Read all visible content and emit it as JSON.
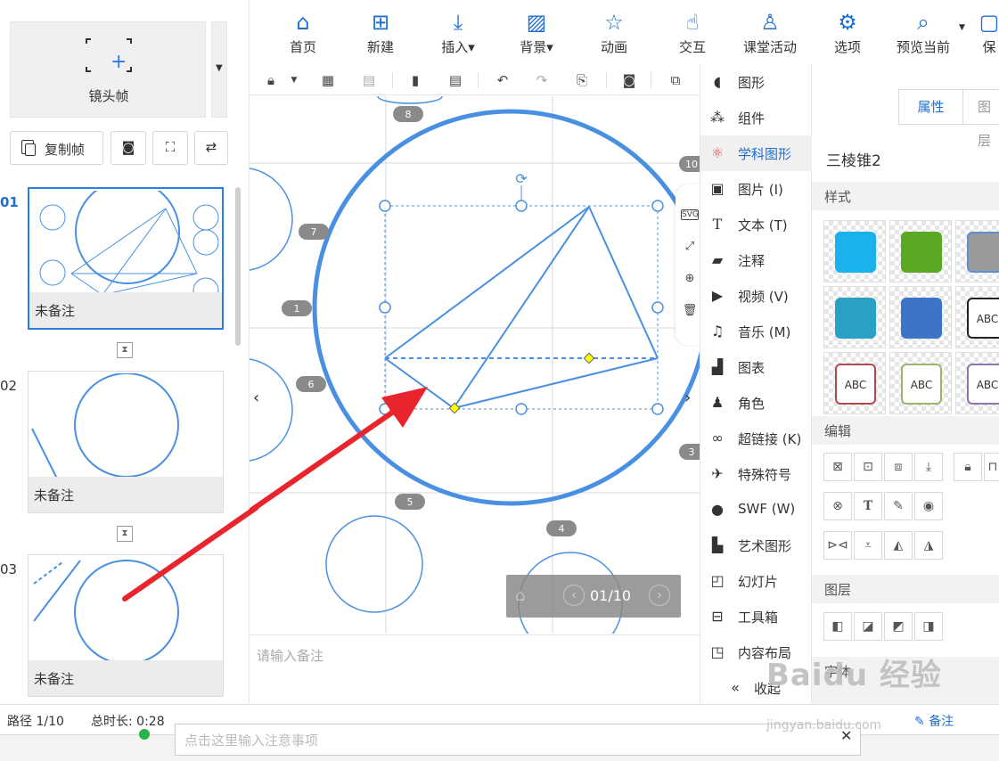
{
  "left_panel": {
    "lens_frame_label": "镜头帧",
    "copy_frame_label": "复制帧",
    "frames": [
      {
        "number": "01",
        "note": "未备注",
        "active": true
      },
      {
        "number": "02",
        "note": "未备注",
        "active": false
      },
      {
        "number": "03",
        "note": "未备注",
        "active": false
      }
    ]
  },
  "toolbar": {
    "items": [
      {
        "label": "首页",
        "icon": "home-icon"
      },
      {
        "label": "新建",
        "icon": "new-icon"
      },
      {
        "label": "插入",
        "icon": "insert-icon",
        "has_dropdown": true
      },
      {
        "label": "背景",
        "icon": "background-icon",
        "has_dropdown": true
      },
      {
        "label": "动画",
        "icon": "animation-icon"
      },
      {
        "label": "交互",
        "icon": "interaction-icon"
      },
      {
        "label": "课堂活动",
        "icon": "class-activity-icon"
      },
      {
        "label": "选项",
        "icon": "options-icon"
      },
      {
        "label": "预览当前",
        "icon": "preview-icon",
        "has_dropdown": true
      },
      {
        "label": "保",
        "icon": "save-icon"
      }
    ]
  },
  "canvas": {
    "path_markers": [
      "8",
      "7",
      "1",
      "6",
      "5",
      "4",
      "10",
      "3"
    ],
    "notes_placeholder": "请输入备注",
    "pager": {
      "text": "01/10"
    }
  },
  "insert_menu": {
    "items": [
      {
        "label": "图形",
        "icon": "shape-icon"
      },
      {
        "label": "组件",
        "icon": "component-icon"
      },
      {
        "label": "学科图形",
        "icon": "subject-shape-icon",
        "active": true
      },
      {
        "label": "图片 (I)",
        "icon": "image-icon"
      },
      {
        "label": "文本 (T)",
        "icon": "text-icon"
      },
      {
        "label": "注释",
        "icon": "comment-icon"
      },
      {
        "label": "视频 (V)",
        "icon": "video-icon"
      },
      {
        "label": "音乐 (M)",
        "icon": "music-icon"
      },
      {
        "label": "图表",
        "icon": "chart-icon"
      },
      {
        "label": "角色",
        "icon": "character-icon"
      },
      {
        "label": "超链接 (K)",
        "icon": "link-icon"
      },
      {
        "label": "特殊符号",
        "icon": "symbol-icon"
      },
      {
        "label": "SWF (W)",
        "icon": "swf-icon"
      },
      {
        "label": "艺术图形",
        "icon": "art-shape-icon"
      },
      {
        "label": "幻灯片",
        "icon": "slide-icon"
      },
      {
        "label": "工具箱",
        "icon": "toolbox-icon"
      },
      {
        "label": "内容布局",
        "icon": "layout-icon"
      }
    ],
    "collapse_label": "收起"
  },
  "properties": {
    "tab_properties": "属性",
    "tab_layers": "图层",
    "object_name": "三棱锥2",
    "section_style": "样式",
    "section_edit": "编辑",
    "section_layer": "图层",
    "section_font": "字体",
    "swatch_text": "ABC",
    "swatches": [
      {
        "color": "#19b2ec",
        "border": "#19b2ec",
        "text": ""
      },
      {
        "color": "#5aa823",
        "border": "#5aa823",
        "text": ""
      },
      {
        "color": "#9a9a9a",
        "border": "#5b8fd8",
        "text": ""
      },
      {
        "color": "#2aa0c4",
        "border": "#2aa0c4",
        "text": ""
      },
      {
        "color": "#3b74c8",
        "border": "#3b74c8",
        "text": ""
      },
      {
        "color": "#ffffff",
        "border": "#222222",
        "text": "ABC"
      },
      {
        "color": "#ffffff",
        "border": "#b04a4a",
        "text": "ABC"
      },
      {
        "color": "#ffffff",
        "border": "#9cb36a",
        "text": "ABC"
      },
      {
        "color": "#ffffff",
        "border": "#8d75b0",
        "text": "ABC"
      }
    ]
  },
  "status": {
    "path": "路径 1/10",
    "duration": "总时长: 0:28",
    "notes_button": "备注"
  },
  "bottom_bar": {
    "placeholder": "点击这里输入注意事项"
  },
  "watermark": {
    "main": "Baidu 经验",
    "sub": "jingyan.baidu.com"
  },
  "colors": {
    "accent": "#1e6fd1",
    "shape_blue": "#4a90e2",
    "arrow_red": "#e8252d",
    "handle_yellow": "#ffff00"
  }
}
